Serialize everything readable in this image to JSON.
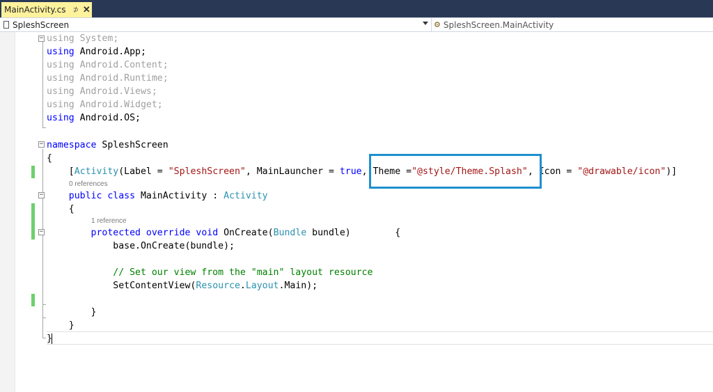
{
  "tab": {
    "label": "MainActivity.cs",
    "pin": "⊅",
    "close": "✕"
  },
  "navbar": {
    "project": "SpleshScreen",
    "member": "SpleshScreen.MainActivity"
  },
  "code": {
    "l1": {
      "kw": "using",
      "rest": " System;"
    },
    "l2": {
      "kw": "using",
      "rest": " Android.App;"
    },
    "l3": {
      "kw": "using",
      "rest": " Android.Content;"
    },
    "l4": {
      "kw": "using",
      "rest": " Android.Runtime;"
    },
    "l5": {
      "kw": "using",
      "rest": " Android.Views;"
    },
    "l6": {
      "kw": "using",
      "rest": " Android.Widget;"
    },
    "l7": {
      "kw": "using",
      "rest": " Android.OS;"
    },
    "l9": {
      "kw": "namespace",
      "rest": " SpleshScreen"
    },
    "l10": "{",
    "l11": {
      "p1": "    [",
      "type": "Activity",
      "p2": "(Label = ",
      "s1": "\"SpleshScreen\"",
      "p3": ", MainLauncher = ",
      "kw": "true",
      "p4": ", Theme =",
      "s2": "\"@style/Theme.Splash\"",
      "p5": ", Icon = ",
      "s3": "\"@drawable/icon\"",
      "p6": ")]"
    },
    "ref0": "0 references",
    "l12": {
      "indent": "    ",
      "kw": "public class",
      "mid": " MainActivity : ",
      "type": "Activity"
    },
    "l13": "    {",
    "ref1": "1 reference",
    "l14": {
      "indent": "        ",
      "kw": "protected override void",
      "mid": " OnCreate(",
      "type": "Bundle",
      "rest": " bundle)        {"
    },
    "l15": "            base.OnCreate(bundle);",
    "l17": "            // Set our view from the \"main\" layout resource",
    "l18": {
      "indent": "            SetContentView(",
      "type1": "Resource",
      "dot": ".",
      "type2": "Layout",
      "rest": ".Main);"
    },
    "l20": "        }",
    "l21": "    }",
    "l22": "}"
  },
  "colors": {
    "accent_box": "#1e8fd0",
    "tab_active": "#fff29d",
    "keyword": "#0000ff",
    "type": "#2b91af",
    "string": "#a31515",
    "comment": "#008000",
    "change_bar": "#6fcf6f"
  }
}
